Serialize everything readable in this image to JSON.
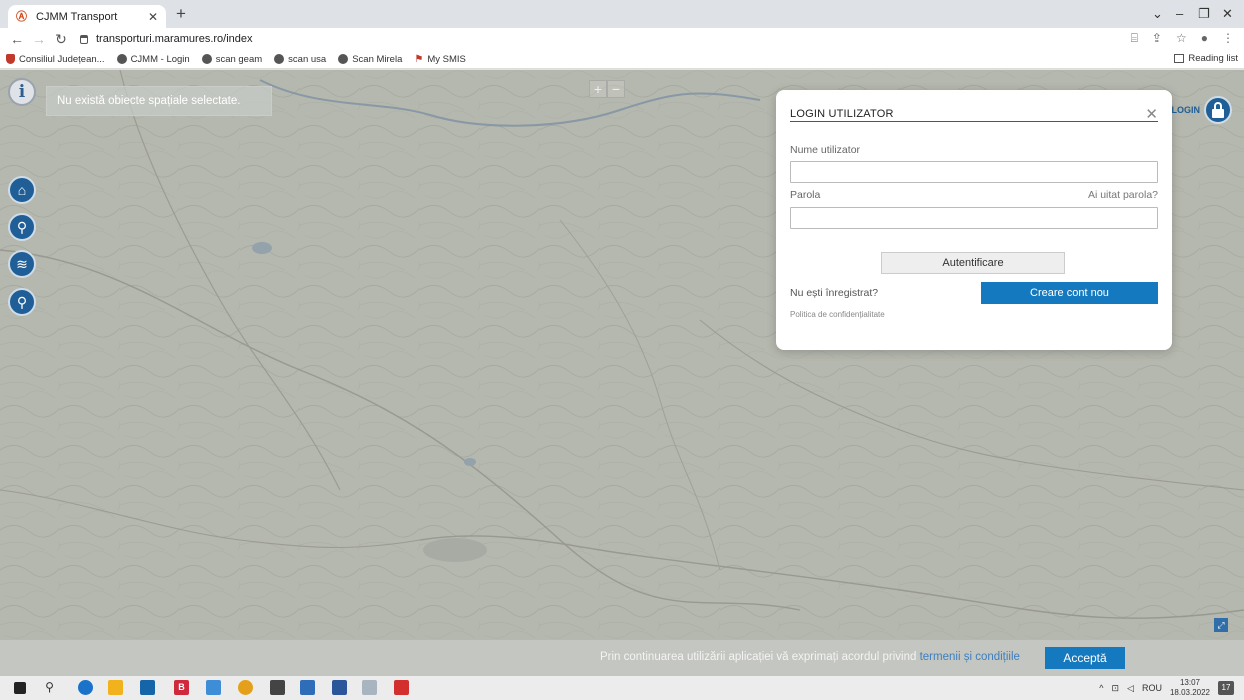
{
  "browser": {
    "tab_title": "CJMM Transport",
    "tab_favicon": "Ⓐ",
    "url": "transporturi.maramures.ro/index",
    "bookmarks": [
      "Consiliul Județean...",
      "CJMM - Login",
      "scan geam",
      "scan usa",
      "Scan Mirela",
      "My SMIS"
    ],
    "reading_list": "Reading list"
  },
  "map": {
    "spatial_placeholder": "Nu există obiecte spațiale selectate.",
    "zoom_in": "+",
    "zoom_out": "−",
    "login_label": "LOGIN"
  },
  "login": {
    "title": "LOGIN UTILIZATOR",
    "username_label": "Nume utilizator",
    "password_label": "Parola",
    "forgot": "Ai uitat parola?",
    "submit": "Autentificare",
    "not_registered": "Nu ești înregistrat?",
    "create_account": "Creare cont nou",
    "policy": "Politica de confidențialitate"
  },
  "consent": {
    "text": "Prin continuarea utilizării aplicației vă exprimați acordul privind ",
    "link": "termenii și condițiile",
    "accept": "Acceptă"
  },
  "taskbar": {
    "language": "ROU",
    "time": "13:07",
    "date": "18.03.2022",
    "notifications": "17"
  }
}
